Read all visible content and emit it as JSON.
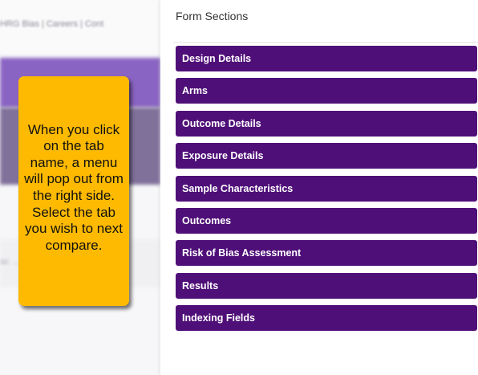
{
  "background": {
    "breadcrumb": "HRG Bias   |   Careers   |   Cont",
    "faint_text": "ac ...                          ared"
  },
  "callout": {
    "text": "When you click on the tab name, a menu will pop out from the right side. Select the tab you wish to next compare."
  },
  "panel": {
    "title": "Form Sections",
    "sections": [
      {
        "label": "Design Details"
      },
      {
        "label": "Arms"
      },
      {
        "label": "Outcome Details"
      },
      {
        "label": "Exposure Details"
      },
      {
        "label": "Sample Characteristics"
      },
      {
        "label": "Outcomes"
      },
      {
        "label": "Risk of Bias Assessment"
      },
      {
        "label": "Results"
      },
      {
        "label": "Indexing Fields"
      }
    ]
  },
  "colors": {
    "section_bg": "#4f0f78",
    "callout_bg": "#fdba00"
  }
}
